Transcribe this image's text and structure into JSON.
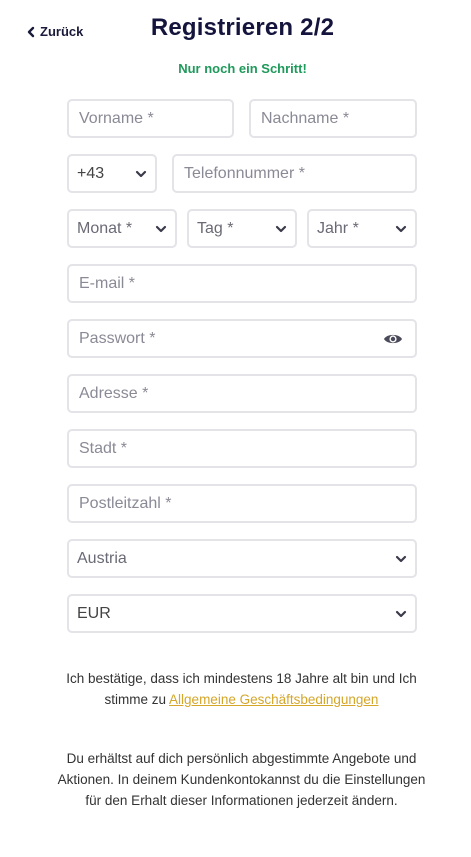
{
  "header": {
    "back_label": "Zurück",
    "title": "Registrieren 2/2",
    "subtitle": "Nur noch ein Schritt!"
  },
  "form": {
    "firstname_placeholder": "Vorname *",
    "lastname_placeholder": "Nachname *",
    "phone_prefix": "+43",
    "phone_placeholder": "Telefonnummer *",
    "month_placeholder": "Monat *",
    "day_placeholder": "Tag *",
    "year_placeholder": "Jahr *",
    "email_placeholder": "E-mail *",
    "password_placeholder": "Passwort *",
    "address_placeholder": "Adresse *",
    "city_placeholder": "Stadt *",
    "zip_placeholder": "Postleitzahl *",
    "country_value": "Austria",
    "currency_value": "EUR"
  },
  "legal": {
    "text_before": "Ich bestätige, dass ich mindestens 18 Jahre alt bin und Ich stimme zu ",
    "terms_link": "Allgemeine Geschäftsbedingungen"
  },
  "info": {
    "text": "Du erhältst auf dich persönlich abgestimmte Angebote und Aktionen. In deinem Kundenkontokannst du die Einstellungen für den Erhalt dieser Informationen jederzeit ändern."
  },
  "colors": {
    "title": "#14143c",
    "subtitle": "#1e9a5a",
    "link": "#d4a62a",
    "border": "#e3e3e8"
  }
}
